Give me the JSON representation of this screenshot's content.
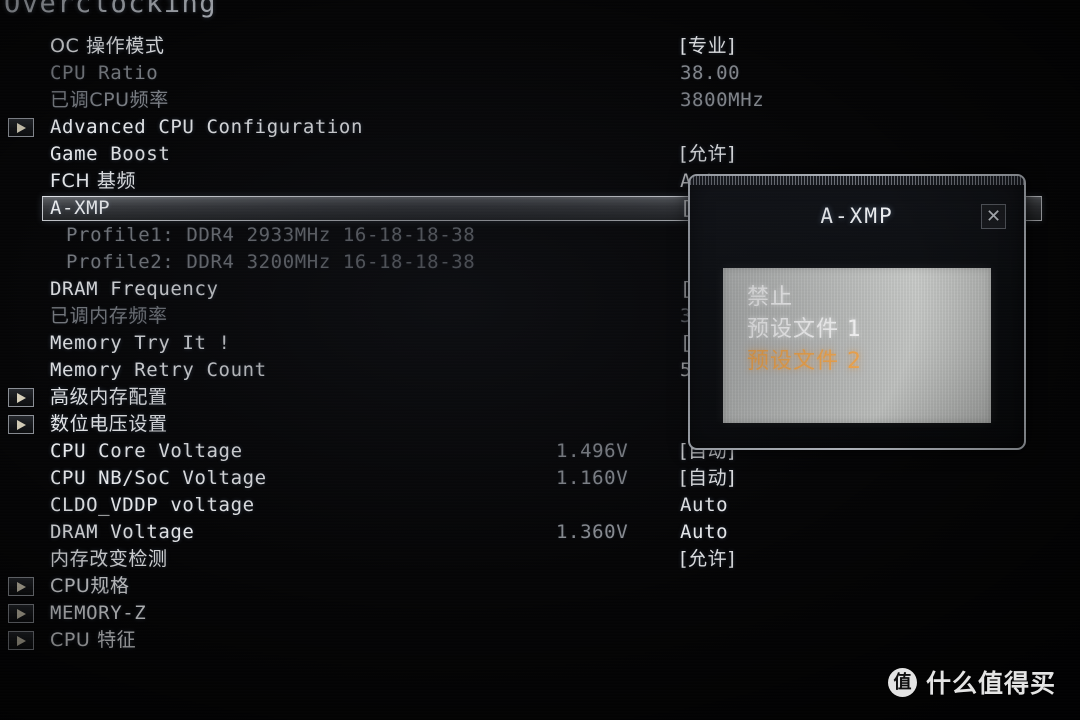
{
  "screen": {
    "title": "Overclocking",
    "value_column_label": "",
    "watermark": {
      "badge": "值",
      "text": "什么值得买"
    }
  },
  "menu": {
    "rows": [
      {
        "arrow": false,
        "label": "OC 操作模式",
        "dim": false,
        "indent": false,
        "cn": true,
        "num": "",
        "value": "[专业]",
        "value_dim": false,
        "value_cn": true,
        "selected": false
      },
      {
        "arrow": false,
        "label": "CPU Ratio",
        "dim": true,
        "indent": false,
        "cn": false,
        "num": "",
        "value": "38.00",
        "value_dim": true,
        "value_cn": false,
        "selected": false
      },
      {
        "arrow": false,
        "label": "已调CPU频率",
        "dim": true,
        "indent": false,
        "cn": true,
        "num": "",
        "value": "3800MHz",
        "value_dim": true,
        "value_cn": false,
        "selected": false
      },
      {
        "arrow": true,
        "label": "Advanced CPU Configuration",
        "dim": false,
        "indent": false,
        "cn": false,
        "num": "",
        "value": "",
        "value_dim": false,
        "value_cn": false,
        "selected": false
      },
      {
        "arrow": false,
        "label": "Game Boost",
        "dim": false,
        "indent": false,
        "cn": false,
        "num": "",
        "value": "[允许]",
        "value_dim": false,
        "value_cn": true,
        "selected": false
      },
      {
        "arrow": false,
        "label": "FCH 基频",
        "dim": false,
        "indent": false,
        "cn": true,
        "num": "",
        "value": "Auto",
        "value_dim": false,
        "value_cn": false,
        "selected": false
      },
      {
        "arrow": false,
        "label": "A-XMP",
        "dim": false,
        "indent": false,
        "cn": false,
        "num": "",
        "value": "[",
        "value_dim": false,
        "value_cn": false,
        "selected": true
      },
      {
        "arrow": false,
        "label": "Profile1: DDR4 2933MHz 16-18-18-38",
        "dim": true,
        "indent": true,
        "cn": false,
        "num": "",
        "value": "",
        "value_dim": true,
        "value_cn": false,
        "selected": false
      },
      {
        "arrow": false,
        "label": "Profile2: DDR4 3200MHz 16-18-18-38",
        "dim": true,
        "indent": true,
        "cn": false,
        "num": "",
        "value": "",
        "value_dim": true,
        "value_cn": false,
        "selected": false
      },
      {
        "arrow": false,
        "label": "DRAM Frequency",
        "dim": false,
        "indent": false,
        "cn": false,
        "num": "",
        "value": "[",
        "value_dim": false,
        "value_cn": false,
        "selected": false
      },
      {
        "arrow": false,
        "label": "已调内存频率",
        "dim": true,
        "indent": false,
        "cn": true,
        "num": "",
        "value": "3",
        "value_dim": true,
        "value_cn": false,
        "selected": false
      },
      {
        "arrow": false,
        "label": "Memory Try It !",
        "dim": false,
        "indent": false,
        "cn": false,
        "num": "",
        "value": "[",
        "value_dim": false,
        "value_cn": false,
        "selected": false
      },
      {
        "arrow": false,
        "label": "Memory Retry Count",
        "dim": false,
        "indent": false,
        "cn": false,
        "num": "",
        "value": "5",
        "value_dim": false,
        "value_cn": false,
        "selected": false
      },
      {
        "arrow": true,
        "label": "高级内存配置",
        "dim": false,
        "indent": false,
        "cn": true,
        "num": "",
        "value": "",
        "value_dim": false,
        "value_cn": false,
        "selected": false
      },
      {
        "arrow": true,
        "label": "数位电压设置",
        "dim": false,
        "indent": false,
        "cn": true,
        "num": "",
        "value": "",
        "value_dim": false,
        "value_cn": false,
        "selected": false
      },
      {
        "arrow": false,
        "label": "CPU Core Voltage",
        "dim": false,
        "indent": false,
        "cn": false,
        "num": "1.496V",
        "value": "[自动]",
        "value_dim": false,
        "value_cn": true,
        "selected": false
      },
      {
        "arrow": false,
        "label": "CPU NB/SoC Voltage",
        "dim": false,
        "indent": false,
        "cn": false,
        "num": "1.160V",
        "value": "[自动]",
        "value_dim": false,
        "value_cn": true,
        "selected": false
      },
      {
        "arrow": false,
        "label": "CLDO_VDDP voltage",
        "dim": false,
        "indent": false,
        "cn": false,
        "num": "",
        "value": "Auto",
        "value_dim": false,
        "value_cn": false,
        "selected": false
      },
      {
        "arrow": false,
        "label": "DRAM Voltage",
        "dim": false,
        "indent": false,
        "cn": false,
        "num": "1.360V",
        "value": "Auto",
        "value_dim": false,
        "value_cn": false,
        "selected": false
      },
      {
        "arrow": false,
        "label": "内存改变检测",
        "dim": false,
        "indent": false,
        "cn": true,
        "num": "",
        "value": "[允许]",
        "value_dim": false,
        "value_cn": true,
        "selected": false
      },
      {
        "arrow": true,
        "label": "CPU规格",
        "dim": false,
        "indent": false,
        "cn": true,
        "num": "",
        "value": "",
        "value_dim": false,
        "value_cn": false,
        "selected": false
      },
      {
        "arrow": true,
        "label": "MEMORY-Z",
        "dim": false,
        "indent": false,
        "cn": false,
        "num": "",
        "value": "",
        "value_dim": false,
        "value_cn": false,
        "selected": false
      },
      {
        "arrow": true,
        "label": "CPU 特征",
        "dim": false,
        "indent": false,
        "cn": true,
        "num": "",
        "value": "",
        "value_dim": false,
        "value_cn": false,
        "selected": false
      }
    ]
  },
  "dialog": {
    "title": "A-XMP",
    "close_label": "✕",
    "options": [
      {
        "label": "禁止",
        "selected": false
      },
      {
        "label": "预设文件 1",
        "selected": false
      },
      {
        "label": "预设文件 2",
        "selected": true
      }
    ]
  }
}
